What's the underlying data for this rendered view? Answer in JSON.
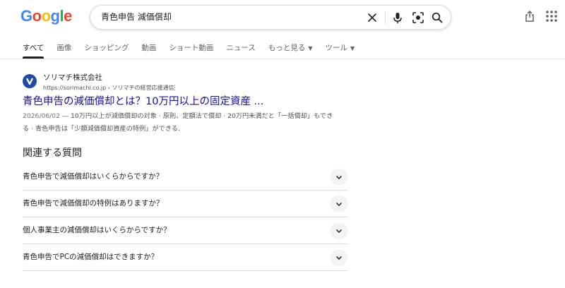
{
  "header": {
    "logo_letters": [
      {
        "ch": "G",
        "color": "#4285f4"
      },
      {
        "ch": "o",
        "color": "#ea4335"
      },
      {
        "ch": "o",
        "color": "#fbbc05"
      },
      {
        "ch": "g",
        "color": "#4285f4"
      },
      {
        "ch": "l",
        "color": "#34a853"
      },
      {
        "ch": "e",
        "color": "#ea4335"
      }
    ],
    "search": {
      "query": "青色申告 減価償却",
      "icons": [
        "clear-icon",
        "mic-icon",
        "lens-icon",
        "search-icon"
      ]
    },
    "right_icons": [
      "share-icon",
      "apps-grid-icon"
    ]
  },
  "tabs": {
    "items": [
      "すべて",
      "画像",
      "ショッピング",
      "動画",
      "ショート動画",
      "ニュース",
      "もっと見る",
      "ツール"
    ],
    "active_index": 0,
    "dropdown_tabs": [
      "もっと見る",
      "ツール"
    ]
  },
  "result": {
    "site_name": "ソリマチ株式会社",
    "url": "https://sorimachi.co.jp › ソリマチの経営応援通信",
    "favicon_color": "#1f4aa8",
    "title": "青色申告の減価償却とは？10万円以上の固定資産 ...",
    "date": "2026/06/02",
    "snippet_line1": " — 10万円以上が減価償却の対象 · 原則、定額法で償却 · 20万円未満だと「一括償却」もでき",
    "snippet_line2": "る · 青色申告は「少額減価償却資産の特例」ができる."
  },
  "related": {
    "title": "関連する質問",
    "questions": [
      "青色申告で減価償却はいくらからですか？",
      "青色申告で減価償却の特例はありますか？",
      "個人事業主の減価償却はいくらからですか？",
      "青色申告でPCの減価償却はできますか？"
    ]
  },
  "colors": {
    "link": "#1a0dab",
    "text": "#202124",
    "muted": "#4d5156"
  }
}
